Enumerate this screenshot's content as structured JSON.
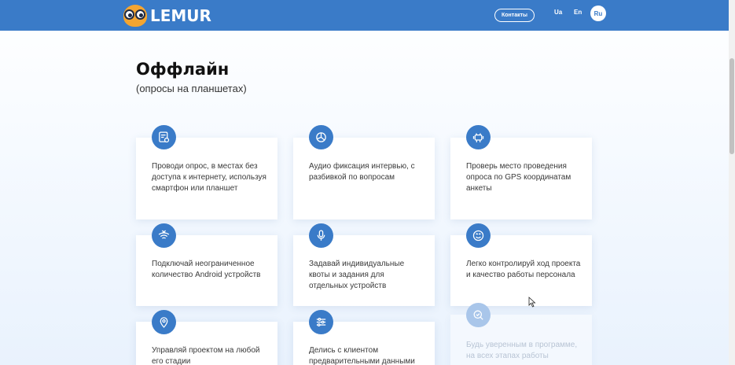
{
  "header": {
    "logo_text": "LEMUR",
    "contacts_label": "Контакты",
    "languages": [
      "Ua",
      "En",
      "Ru"
    ],
    "active_language": "Ru"
  },
  "section": {
    "title": "Оффлайн",
    "subtitle": "(опросы на планшетах)"
  },
  "features": [
    {
      "icon": "tablet-survey-icon",
      "text": "Проводи опрос, в местах без доступа к интернету, используя смартфон или планшет"
    },
    {
      "icon": "pie-chart-icon",
      "text": "Аудио фиксация интервью, с разбивкой по вопросам"
    },
    {
      "icon": "android-robot-icon",
      "text": "Проверь место проведения опроса по GPS координатам анкеты"
    },
    {
      "icon": "no-wifi-icon",
      "text": "Подключай неограниченное количество Android устройств"
    },
    {
      "icon": "microphone-icon",
      "text": "Задавай индивидуальные квоты и задания для отдельных устройств"
    },
    {
      "icon": "smiley-icon",
      "text": "Легко контролируй ход проекта и качество работы персонала"
    },
    {
      "icon": "location-pin-icon",
      "text": "Управляй проектом на любой его стадии"
    },
    {
      "icon": "sliders-icon",
      "text": "Делись с клиентом предварительными данными"
    },
    {
      "icon": "magnifier-check-icon",
      "text": "Будь уверенным в программе, на всех этапах работы"
    }
  ],
  "colors": {
    "header_bg": "#3a7bc8",
    "icon_bg": "#3a7bc8",
    "icon_faded_bg": "#a9c6ea"
  }
}
